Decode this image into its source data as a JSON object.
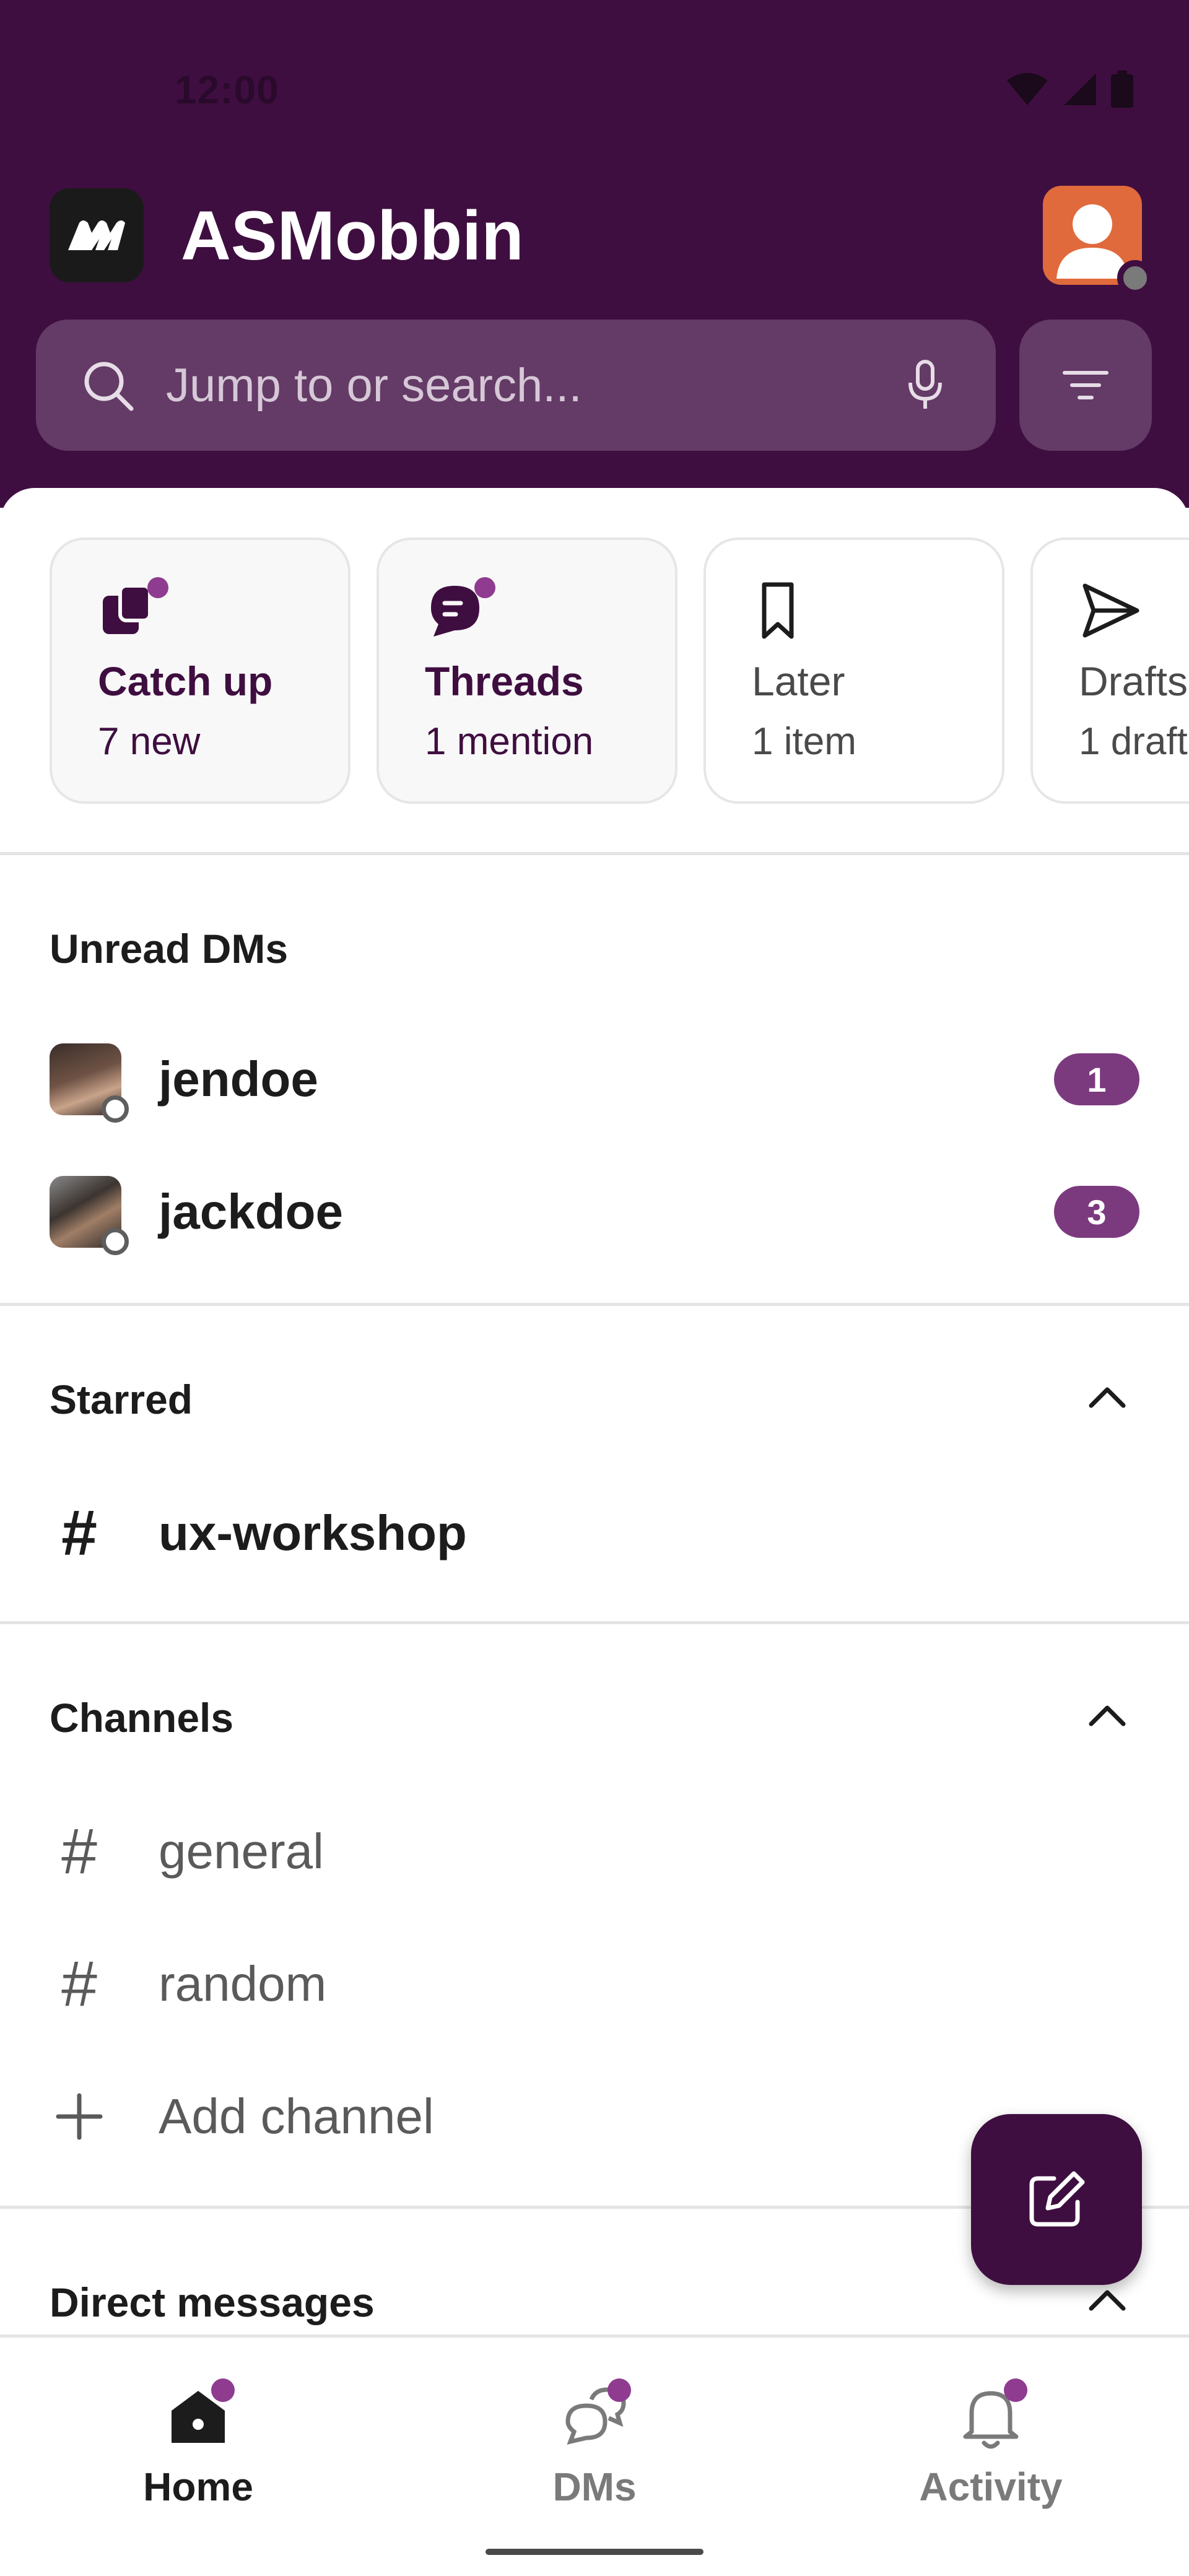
{
  "status_bar": {
    "time": "12:00"
  },
  "workspace": {
    "name": "ASMobbin"
  },
  "search": {
    "placeholder": "Jump to or search..."
  },
  "quick_cards": [
    {
      "title": "Catch up",
      "subtitle": "7 new",
      "icon": "catch-up-icon",
      "has_badge": true
    },
    {
      "title": "Threads",
      "subtitle": "1 mention",
      "icon": "threads-icon",
      "has_badge": true
    },
    {
      "title": "Later",
      "subtitle": "1 item",
      "icon": "bookmark-icon",
      "has_badge": false
    },
    {
      "title": "Drafts",
      "subtitle": "1 draft",
      "icon": "send-icon",
      "has_badge": false
    }
  ],
  "unread_dms": {
    "title": "Unread DMs",
    "items": [
      {
        "name": "jendoe",
        "count": "1"
      },
      {
        "name": "jackdoe",
        "count": "3"
      }
    ]
  },
  "starred": {
    "title": "Starred",
    "channels": [
      {
        "name": "ux-workshop"
      }
    ]
  },
  "channels": {
    "title": "Channels",
    "items": [
      {
        "name": "general"
      },
      {
        "name": "random"
      }
    ],
    "add_label": "Add channel"
  },
  "direct_messages": {
    "title": "Direct messages"
  },
  "bottom_nav": [
    {
      "label": "Home",
      "active": true
    },
    {
      "label": "DMs",
      "active": false
    },
    {
      "label": "Activity",
      "active": false
    }
  ],
  "colors": {
    "aubergine": "#3f0e40",
    "badge": "#7c3a7e",
    "notification_dot": "#8e3b90"
  }
}
